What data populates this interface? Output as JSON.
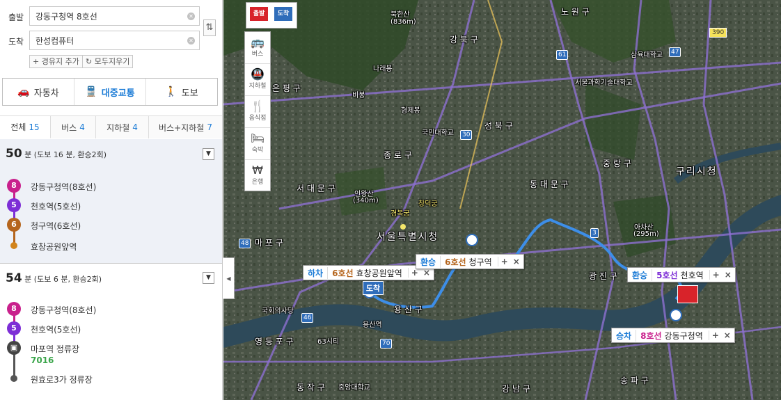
{
  "search": {
    "origin_label": "출발",
    "origin_value": "강동구청역 8호선",
    "dest_label": "도착",
    "dest_value": "한성컴퓨터",
    "add_waypoint": "+ 경유지 추가",
    "clear_all": "모두지우기"
  },
  "modes": [
    {
      "icon": "car-icon",
      "label": "자동차",
      "active": false
    },
    {
      "icon": "transit-icon",
      "label": "대중교통",
      "active": true
    },
    {
      "icon": "walk-icon",
      "label": "도보",
      "active": false
    }
  ],
  "tabs": [
    {
      "label": "전체",
      "count": "15"
    },
    {
      "label": "버스",
      "count": "4"
    },
    {
      "label": "지하철",
      "count": "4"
    },
    {
      "label": "버스+지하철",
      "count": "7"
    }
  ],
  "routes": [
    {
      "minutes": "50",
      "unit": "분",
      "detail": "(도보 16 분, 환승2회)",
      "stops": [
        {
          "badge": "8",
          "color": "#c9208c",
          "name": "강동구청역(8호선)"
        },
        {
          "badge": "5",
          "color": "#7d2ed6",
          "name": "천호역(5호선)"
        },
        {
          "badge": "6",
          "color": "#b5651d",
          "name": "청구역(6호선)"
        },
        {
          "badge": "",
          "color": "#d2841c",
          "name": "효창공원앞역"
        }
      ]
    },
    {
      "minutes": "54",
      "unit": "분",
      "detail": "(도보 6 분, 환승2회)",
      "stops": [
        {
          "badge": "8",
          "color": "#c9208c",
          "name": "강동구청역(8호선)"
        },
        {
          "badge": "5",
          "color": "#7d2ed6",
          "name": "천호역(5호선)"
        },
        {
          "badge": "bus",
          "color": "#444444",
          "name": "마포역 정류장",
          "bus_no": "7016"
        },
        {
          "badge": "",
          "color": "#555555",
          "name": "원효로3가 정류장"
        }
      ]
    }
  ],
  "map": {
    "toolbar_top": {
      "start": "출발",
      "end": "도착"
    },
    "tools": [
      "버스",
      "지하철",
      "음식점",
      "숙박",
      "은행"
    ],
    "labels": {
      "seoul": "서울특별시청",
      "guri": "구리시청",
      "jongno": "종 로 구",
      "seongbuk": "성 북 구",
      "gangbuk": "강 북 구",
      "seodaemun": "서 대 문 구",
      "mapo": "마 포 구",
      "dongdaemun": "동 대 문 구",
      "jungnang": "중 랑 구",
      "gwangjin": "광 진 구",
      "yongsan": "용 산 구",
      "yeongdeungpo": "영 등 포 구",
      "dongjak": "동 작 구",
      "gangnam": "강 남 구",
      "songpa": "송 파 구",
      "eunpyeong": "은 평 구",
      "nowon": "노 원 구",
      "bukhansan": "북한산",
      "bukhansan_h": "(836m)",
      "naraebong": "나래봉",
      "inwangsan": "인왕산",
      "inwangsan_h": "(340m)",
      "achasan": "아차산",
      "achasan_h": "(295m)",
      "gyeongbokgung": "경복궁",
      "changdeokgung": "창덕궁",
      "hyeongjebong": "형제봉",
      "bibong": "비봉",
      "yongsan_st": "용산역",
      "yeouido": "국회의사당",
      "sixty_three": "63시티",
      "gukmin": "국민대학교",
      "seoulgwagi": "서울과학기술대학교",
      "sahmyook": "삼육대학교",
      "gukbang": "중앙대학교",
      "gachon": "구리시"
    },
    "popups": [
      {
        "action": "하차",
        "line": "6호선",
        "line_color": "#b5651d",
        "station": "효창공원앞역"
      },
      {
        "action": "환승",
        "line": "6호선",
        "line_color": "#b5651d",
        "station": "청구역"
      },
      {
        "action": "환승",
        "line": "5호선",
        "line_color": "#7d2ed6",
        "station": "천호역"
      },
      {
        "action": "승차",
        "line": "8호선",
        "line_color": "#c9208c",
        "station": "강동구청역"
      }
    ],
    "end_marker": "도착",
    "road_numbers": [
      "3",
      "30",
      "61",
      "47",
      "48",
      "46",
      "70",
      "390"
    ]
  }
}
